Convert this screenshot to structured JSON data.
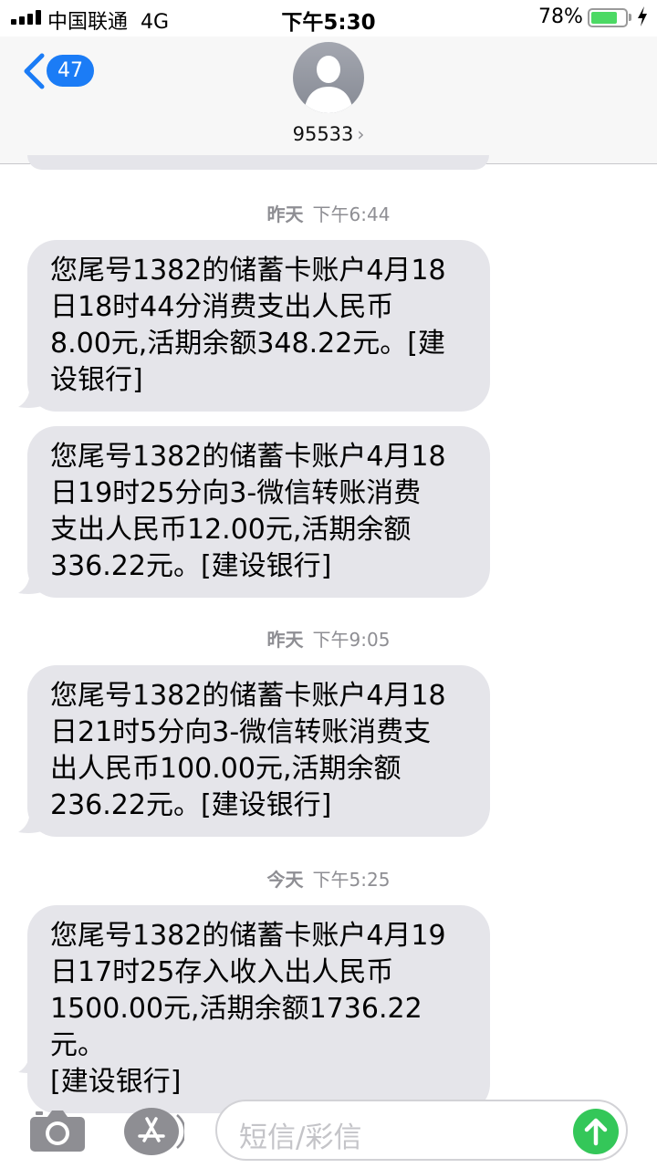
{
  "status_bar": {
    "carrier": "中国联通",
    "network": "4G",
    "time": "下午5:30",
    "battery_percent": "78%",
    "battery_level": 0.78,
    "battery_color": "#4cd964"
  },
  "header": {
    "back_count": "47",
    "contact": "95533",
    "accent_color": "#1b7cf6"
  },
  "messages": [
    {
      "day": "昨天",
      "time": "下午6:44"
    },
    {
      "text": "您尾号1382的储蓄卡账户4月18日18时44分消费支出人民币8.00元,活期余额348.22元。[建设银行]",
      "lines": [
        "您尾号1382的储蓄卡账户4月18",
        "日18时44分消费支出人民币",
        "8.00元,活期余额348.22元。[建",
        "设银行]"
      ]
    },
    {
      "text": "您尾号1382的储蓄卡账户4月18日19时25分向3-微信转账消费支出人民币12.00元,活期余额336.22元。[建设银行]",
      "lines": [
        "您尾号1382的储蓄卡账户4月18",
        "日19时25分向3-微信转账消费",
        "支出人民币12.00元,活期余额",
        "336.22元。[建设银行]"
      ]
    },
    {
      "day": "昨天",
      "time": "下午9:05"
    },
    {
      "text": "您尾号1382的储蓄卡账户4月18日21时5分向3-微信转账消费支出人民币100.00元,活期余额236.22元。[建设银行]",
      "lines": [
        "您尾号1382的储蓄卡账户4月18",
        "日21时5分向3-微信转账消费支",
        "出人民币100.00元,活期余额",
        "236.22元。[建设银行]"
      ]
    },
    {
      "day": "今天",
      "time": "下午5:25"
    },
    {
      "text": "您尾号1382的储蓄卡账户4月19日17时25存入收入出人民币1500.00元,活期余额1736.22元。[建设银行]",
      "lines": [
        "您尾号1382的储蓄卡账户4月19",
        "日17时25存入收入出人民币",
        "1500.00元,活期余额1736.22元。",
        "[建设银行]"
      ]
    }
  ],
  "composer": {
    "placeholder": "短信/彩信",
    "camera_icon": "camera-icon",
    "apps_icon": "app-store-icon",
    "send_icon": "send-arrow-icon",
    "send_color": "#34c759"
  }
}
